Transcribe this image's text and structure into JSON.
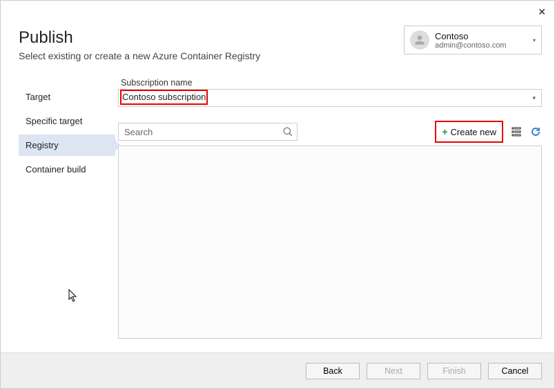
{
  "window": {
    "close_glyph": "✕"
  },
  "header": {
    "title": "Publish",
    "subtitle": "Select existing or create a new Azure Container Registry"
  },
  "account": {
    "name": "Contoso",
    "email": "admin@contoso.com",
    "caret": "▾"
  },
  "sidebar": {
    "items": [
      {
        "label": "Target"
      },
      {
        "label": "Specific target"
      },
      {
        "label": "Registry"
      },
      {
        "label": "Container build"
      }
    ],
    "active_index": 2
  },
  "subscription": {
    "label": "Subscription name",
    "value": "Contoso subscription",
    "caret": "▾"
  },
  "search": {
    "placeholder": "Search"
  },
  "create_new": {
    "plus": "+",
    "label": "Create new"
  },
  "footer": {
    "back": "Back",
    "next": "Next",
    "finish": "Finish",
    "cancel": "Cancel"
  }
}
